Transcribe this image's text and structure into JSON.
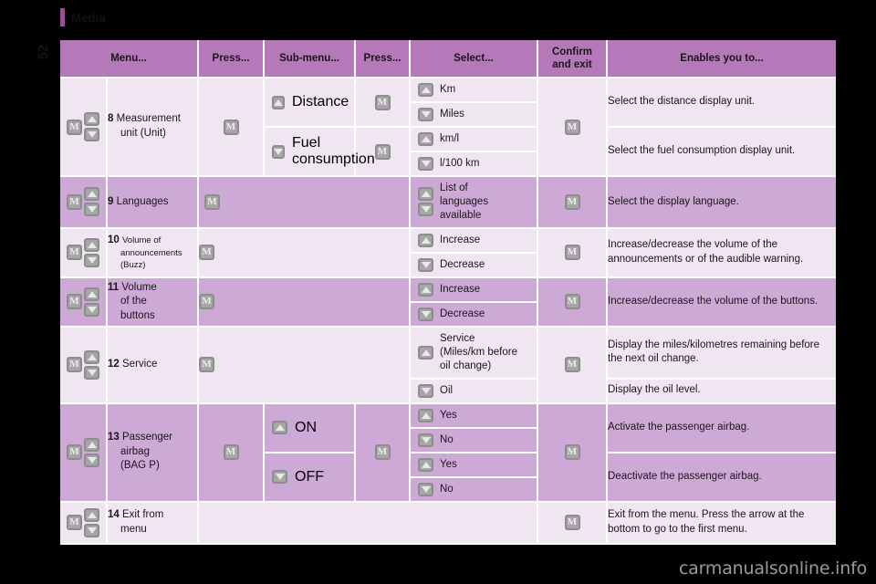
{
  "chapter": {
    "title": "Media"
  },
  "page_number": "52",
  "watermark": "carmanualsonline.info",
  "table": {
    "headers": [
      "Menu...",
      "Press...",
      "Sub-menu...",
      "Press...",
      "Select...",
      "Confirm and exit",
      "Enables you to..."
    ],
    "header_confirm_line1": "Confirm",
    "header_confirm_line2": "and exit",
    "key_label": "M",
    "rows": [
      {
        "num": "8",
        "name": "Measurement unit (Unit)",
        "name_line1": "Measurement",
        "name_line2": "unit (Unit)",
        "press1": "M",
        "submenus": [
          "Distance",
          "Fuel consumption"
        ],
        "submenu2_line1": "Fuel",
        "submenu2_line2": "consumption",
        "press2": [
          "M",
          "M"
        ],
        "selects": [
          "Km",
          "Miles",
          "km/l",
          "l/100 km"
        ],
        "confirm": "M",
        "descriptions": [
          "Select the distance display unit.",
          "Select the fuel consumption display unit."
        ]
      },
      {
        "num": "9",
        "name": "Languages",
        "press1": "M",
        "submenus": [],
        "selects": [
          "List of languages available"
        ],
        "select_line1": "List of",
        "select_line2": "languages",
        "select_line3": "available",
        "confirm": "M",
        "descriptions": [
          "Select the display language."
        ]
      },
      {
        "num": "10",
        "name": "Volume of announcements (Buzz)",
        "name_line1": "Volume of",
        "name_line2": "announcements",
        "name_line3": "(Buzz)",
        "press1": "M",
        "submenus": [],
        "selects": [
          "Increase",
          "Decrease"
        ],
        "confirm": "M",
        "descriptions": [
          "Increase/decrease the volume of the announcements or of the audible warning."
        ]
      },
      {
        "num": "11",
        "name": "Volume of the buttons",
        "name_line1": "Volume",
        "name_line2": "of the",
        "name_line3": "buttons",
        "press1": "M",
        "submenus": [],
        "selects": [
          "Increase",
          "Decrease"
        ],
        "confirm": "M",
        "descriptions": [
          "Increase/decrease the volume of the buttons."
        ]
      },
      {
        "num": "12",
        "name": "Service",
        "press1": "M",
        "submenus": [],
        "selects": [
          "Service (Miles/km before oil change)",
          "Oil"
        ],
        "select_line1": "Service",
        "select_line2": "(Miles/km before",
        "select_line3": "oil change)",
        "confirm": "M",
        "descriptions": [
          "Display the miles/kilometres remaining before the next oil change.",
          "Display the oil level."
        ]
      },
      {
        "num": "13",
        "name": "Passenger airbag (BAG P)",
        "name_line1": "Passenger",
        "name_line2": "airbag",
        "name_line3": "(BAG P)",
        "press1": "M",
        "submenus": [
          "ON",
          "OFF"
        ],
        "press2": "M",
        "selects": [
          "Yes",
          "No",
          "Yes",
          "No"
        ],
        "confirm": "M",
        "descriptions": [
          "Activate the passenger airbag.",
          "Deactivate the passenger airbag."
        ]
      },
      {
        "num": "14",
        "name": "Exit from menu",
        "name_line1": "Exit from",
        "name_line2": "menu",
        "press1": "",
        "submenus": [],
        "selects": [],
        "confirm": "M",
        "descriptions": [
          "Exit from the menu. Press the arrow at the bottom to go to the first menu."
        ]
      }
    ]
  }
}
